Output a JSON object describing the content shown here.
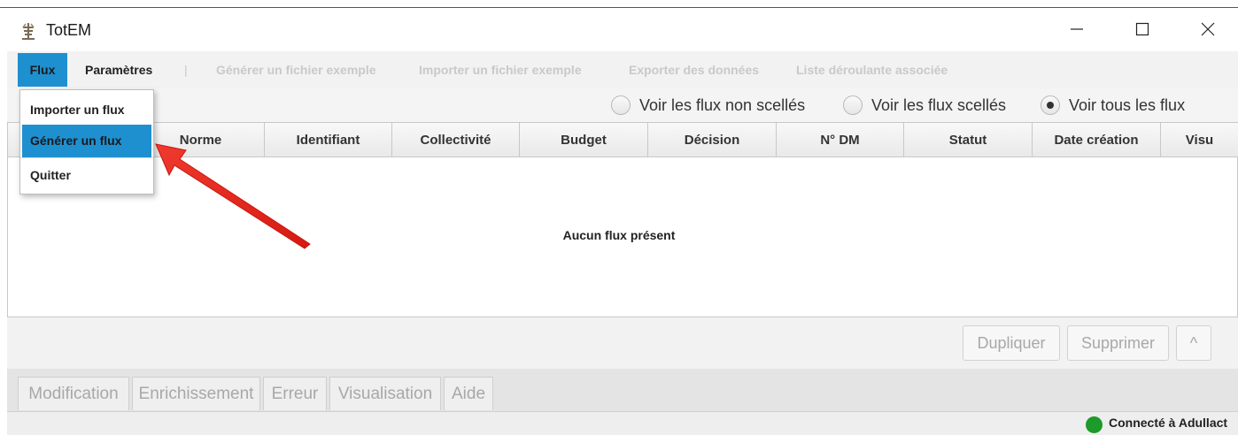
{
  "window": {
    "title": "TotEM",
    "controls": [
      "minimize",
      "maximize",
      "close"
    ]
  },
  "menubar": {
    "items": [
      "Flux",
      "Paramètres"
    ],
    "separator": "|",
    "disabled_items": [
      "Générer un fichier exemple",
      "Importer un fichier exemple",
      "Exporter des données",
      "Liste déroulante associée"
    ]
  },
  "flux_menu": {
    "items": [
      "Importer un flux",
      "Générer un flux",
      "Quitter"
    ],
    "highlighted": "Générer un flux"
  },
  "filters": {
    "options": [
      "Voir les flux non scellés",
      "Voir les flux scellés",
      "Voir tous les flux"
    ],
    "selected": "Voir tous les flux"
  },
  "table": {
    "columns": [
      "Norme",
      "Identifiant",
      "Collectivité",
      "Budget",
      "Décision",
      "N° DM",
      "Statut",
      "Date création",
      "Visu"
    ],
    "empty_message": "Aucun flux présent"
  },
  "actions": {
    "duplicate": "Dupliquer",
    "delete": "Supprimer",
    "up": "^"
  },
  "tabs": [
    "Modification",
    "Enrichissement",
    "Erreur",
    "Visualisation",
    "Aide"
  ],
  "status": {
    "text": "Connecté à Adullact",
    "color": "#1c9a2a"
  },
  "colors": {
    "accent": "#1e90d0",
    "annotation_arrow": "#e8221c"
  }
}
